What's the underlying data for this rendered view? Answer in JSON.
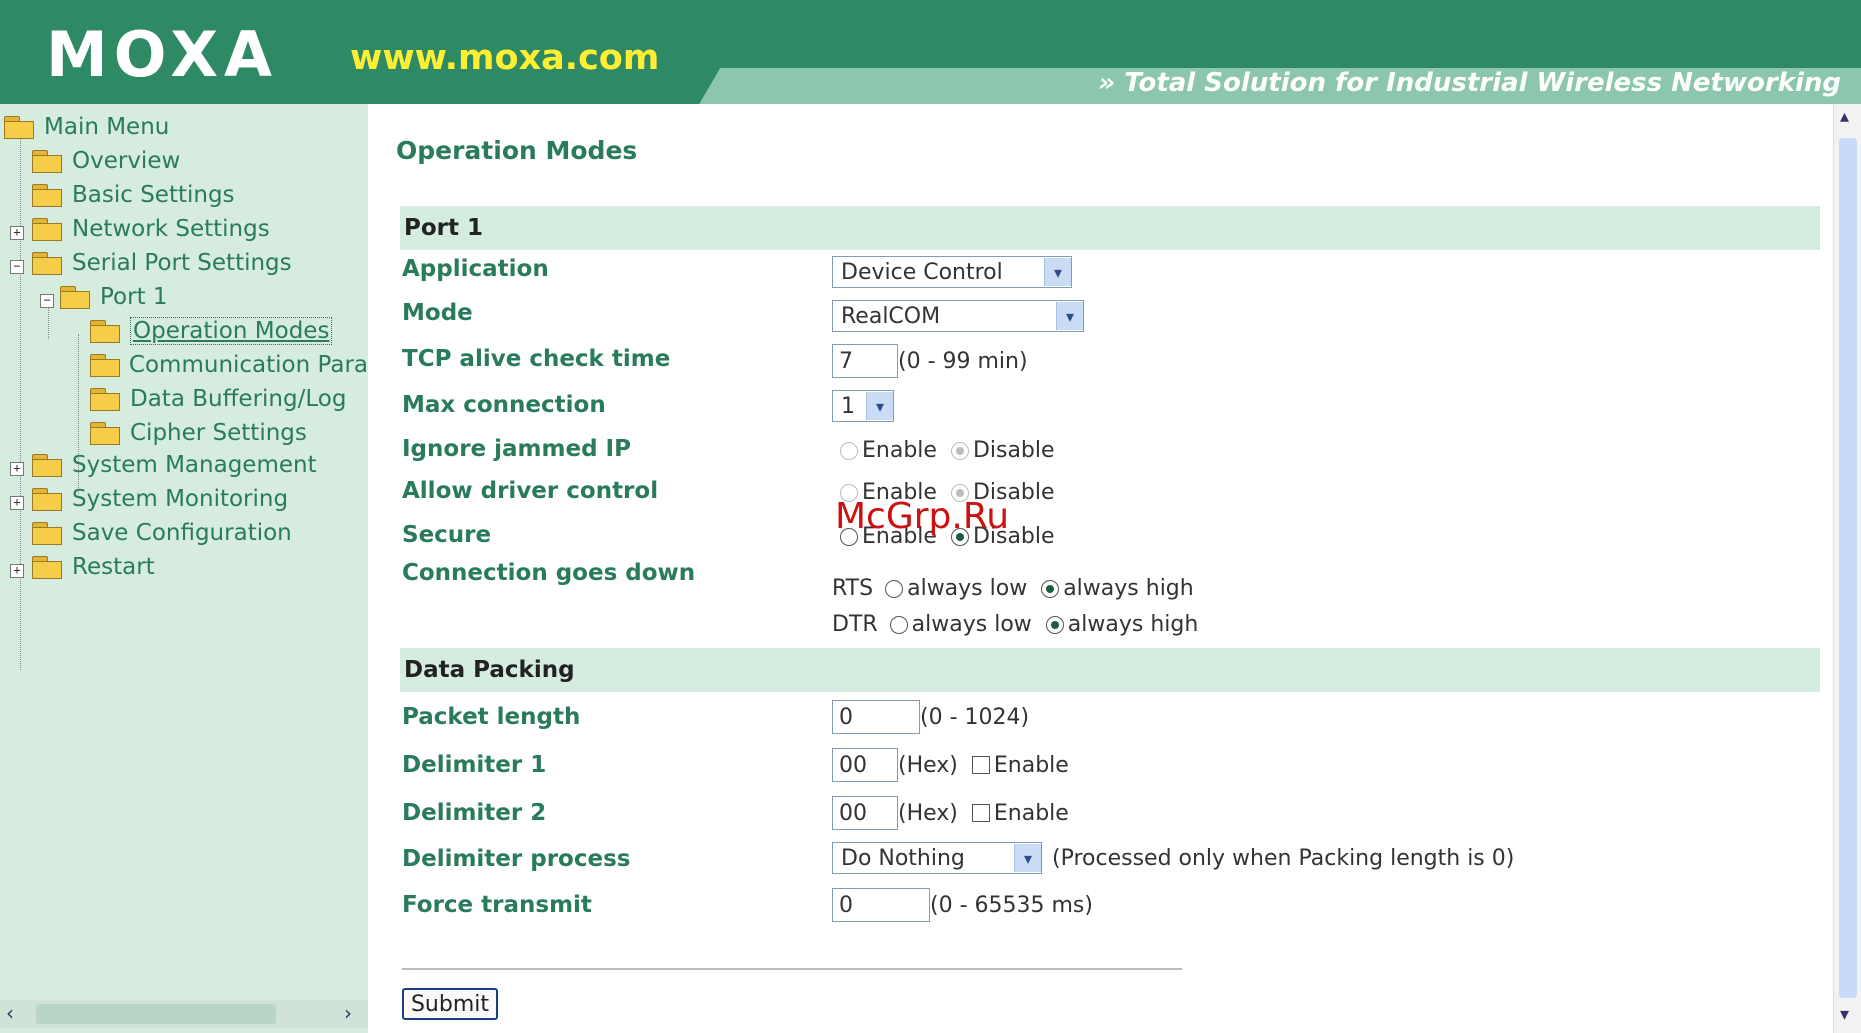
{
  "header": {
    "logo": "MOXA",
    "url": "www.moxa.com",
    "tagline": "» Total Solution for Industrial Wireless Networking"
  },
  "sidebar": {
    "items": [
      {
        "label": "Main Menu"
      },
      {
        "label": "Overview"
      },
      {
        "label": "Basic Settings"
      },
      {
        "label": "Network Settings",
        "expander": "+"
      },
      {
        "label": "Serial Port Settings",
        "expander": "−"
      },
      {
        "label": "Port 1",
        "expander": "−"
      },
      {
        "label": "Operation Modes"
      },
      {
        "label": "Communication Para"
      },
      {
        "label": "Data Buffering/Log"
      },
      {
        "label": "Cipher Settings"
      },
      {
        "label": "System Management",
        "expander": "+"
      },
      {
        "label": "System Monitoring",
        "expander": "+"
      },
      {
        "label": "Save Configuration"
      },
      {
        "label": "Restart",
        "expander": "+"
      }
    ]
  },
  "main": {
    "title": "Operation Modes",
    "port_section": "Port 1",
    "application": {
      "label": "Application",
      "value": "Device Control"
    },
    "mode": {
      "label": "Mode",
      "value": "RealCOM"
    },
    "tcp_alive": {
      "label": "TCP alive check time",
      "value": "7",
      "hint": "(0 - 99 min)"
    },
    "max_connection": {
      "label": "Max connection",
      "value": "1"
    },
    "ignore_jammed": {
      "label": "Ignore jammed IP",
      "enable": "Enable",
      "disable": "Disable"
    },
    "allow_driver": {
      "label": "Allow driver control",
      "enable": "Enable",
      "disable": "Disable"
    },
    "secure": {
      "label": "Secure",
      "enable": "Enable",
      "disable": "Disable"
    },
    "conn_down": {
      "label": "Connection goes down",
      "rts": "RTS",
      "dtr": "DTR",
      "low": "always low",
      "high": "always high"
    },
    "packing_section": "Data Packing",
    "packet_length": {
      "label": "Packet length",
      "value": "0",
      "hint": "(0 - 1024)"
    },
    "delimiter1": {
      "label": "Delimiter 1",
      "value": "00",
      "hex": "(Hex)",
      "enable": "Enable"
    },
    "delimiter2": {
      "label": "Delimiter 2",
      "value": "00",
      "hex": "(Hex)",
      "enable": "Enable"
    },
    "delimiter_process": {
      "label": "Delimiter process",
      "value": "Do Nothing",
      "hint": "(Processed only when Packing length is 0)"
    },
    "force_transmit": {
      "label": "Force transmit",
      "value": "0",
      "hint": "(0 - 65535 ms)"
    },
    "submit": "Submit"
  },
  "watermark": "McGrp.Ru"
}
